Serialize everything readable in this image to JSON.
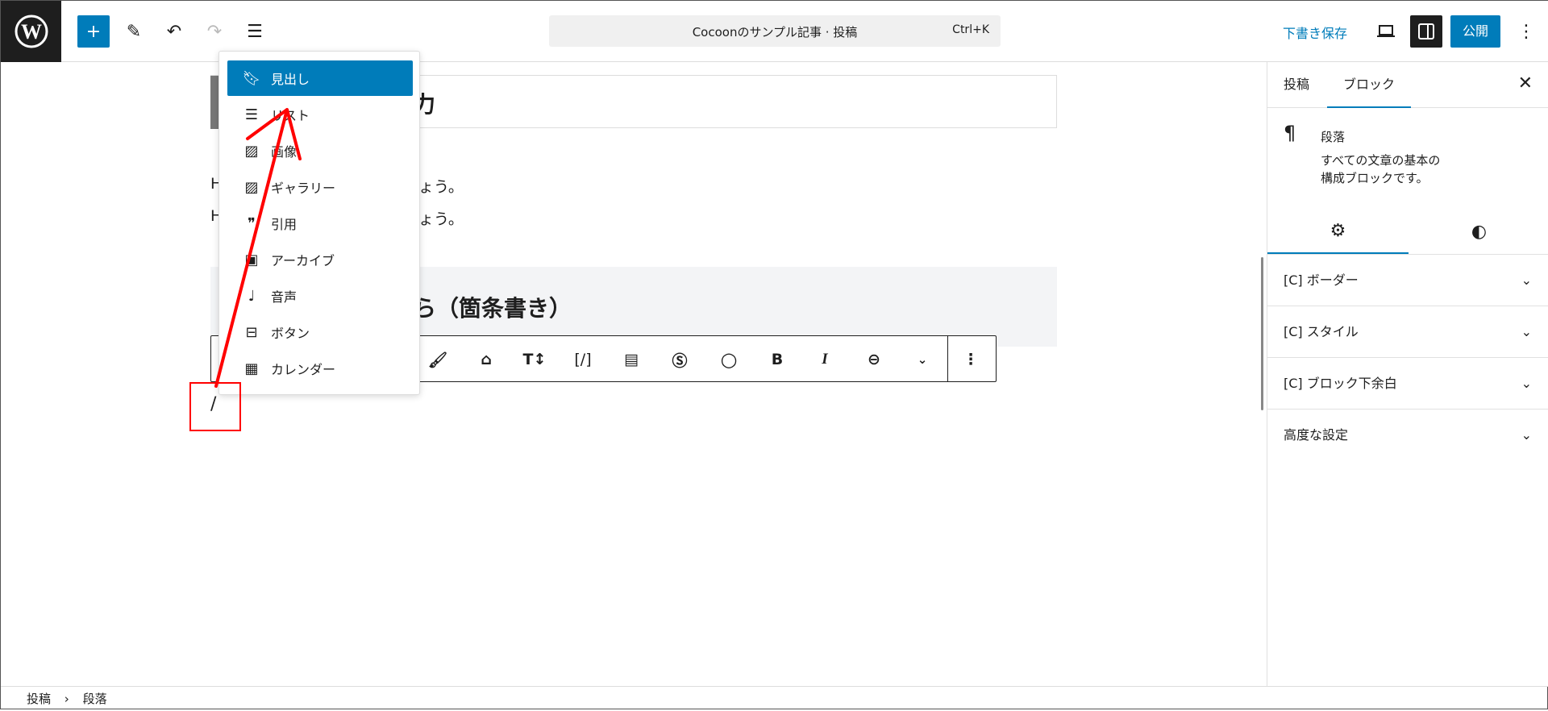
{
  "header": {
    "add_label": "+",
    "command_title": "Cocoonのサンプル記事 · 投稿",
    "command_shortcut": "Ctrl+K",
    "save_draft": "下書き保存",
    "publish": "公開"
  },
  "editor": {
    "title_visible": "力",
    "para1_start": "H",
    "para1_end": "ょう。",
    "para2_start": "H",
    "para2_end": "ょう。",
    "heading_visible": "ら（箇条書き）",
    "slash_text": "/"
  },
  "inserter_menu": {
    "items": [
      {
        "label": "見出し",
        "icon": "bookmark-icon"
      },
      {
        "label": "リスト",
        "icon": "list-icon"
      },
      {
        "label": "画像",
        "icon": "image-icon"
      },
      {
        "label": "ギャラリー",
        "icon": "gallery-icon"
      },
      {
        "label": "引用",
        "icon": "quote-icon"
      },
      {
        "label": "アーカイブ",
        "icon": "archive-icon"
      },
      {
        "label": "音声",
        "icon": "audio-icon"
      },
      {
        "label": "ボタン",
        "icon": "button-icon"
      },
      {
        "label": "カレンダー",
        "icon": "calendar-icon"
      }
    ]
  },
  "block_toolbar": {
    "bold": "B",
    "italic": "I",
    "font_size": "T↕",
    "shortcode": "[/]"
  },
  "sidebar": {
    "tabs": [
      "投稿",
      "ブロック"
    ],
    "block_name": "段落",
    "block_desc_1": "すべての文章の基本の",
    "block_desc_2": "構成ブロックです。",
    "panels": [
      "[C] ボーダー",
      "[C] スタイル",
      "[C] ブロック下余白",
      "高度な設定"
    ]
  },
  "breadcrumb": [
    "投稿",
    "段落"
  ],
  "colors": {
    "accent": "#007cba",
    "annotation": "#ff0000",
    "dark": "#1e1e1e"
  }
}
